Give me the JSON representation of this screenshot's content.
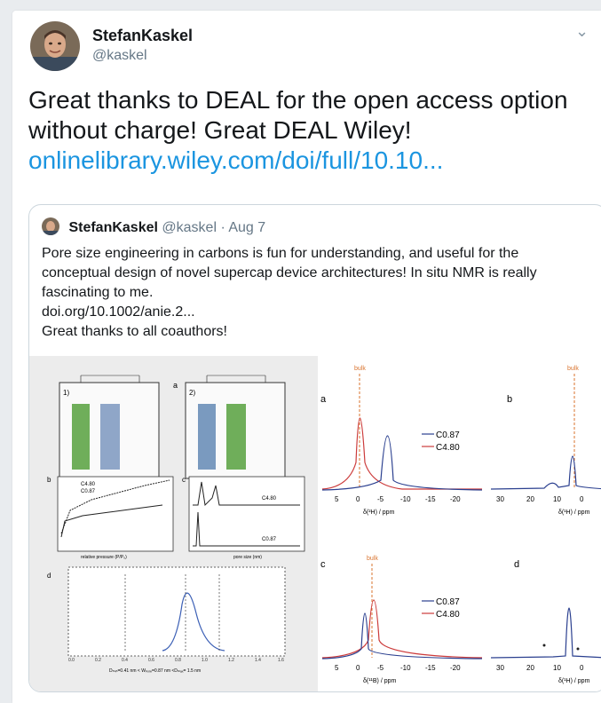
{
  "tweet": {
    "author_name": "StefanKaskel",
    "author_handle": "@kaskel",
    "text_line1": "Great thanks to DEAL for the open access option",
    "text_line2": "without charge! Great DEAL Wiley!",
    "link": "onlinelibrary.wiley.com/doi/full/10.10..."
  },
  "quoted": {
    "author_name": "StefanKaskel",
    "handle_date": "@kaskel · Aug 7",
    "lines": [
      "Pore size engineering in carbons is fun for understanding, and useful for the",
      "conceptual design of novel supercap device architectures! In situ NMR is really",
      "fascinating to me.",
      "doi.org/10.1002/anie.2...",
      "Great thanks to all coauthors!"
    ]
  },
  "figure": {
    "colors": {
      "blue": "#2a3f8f",
      "red": "#cc3b3b",
      "bulk": "#d9732e"
    },
    "left": {
      "panel1": "1)",
      "panel2": "2)",
      "panel_a": "a",
      "panel_b": "b",
      "panel_c": "c",
      "panel_d": "d",
      "legend_b": [
        "C4.80",
        "C0.87"
      ],
      "legend_c": [
        "C4.80",
        "C0.87"
      ],
      "xlabel_b": "relative pressure (P/P₀)",
      "xlabel_c": "pore size (nm)",
      "d_ticks": [
        "0.0",
        "0.2",
        "0.4",
        "0.6",
        "0.8",
        "1.0",
        "1.2",
        "1.4",
        "1.6"
      ],
      "d_caption": "Dₘᵢₙ=0.41 nm  <  Wₚₒᵣₑ=0.87 nm  <Dₘₐₓ= 1.5 nm"
    },
    "nmr": {
      "bulk": "bulk",
      "a": {
        "label": "a",
        "legend": [
          "C0.87",
          "C4.80"
        ],
        "ticks": [
          "5",
          "0",
          "-5",
          "-10",
          "-15",
          "-20"
        ],
        "xlabel": "δ(²H) / ppm"
      },
      "b": {
        "label": "b",
        "ticks": [
          "30",
          "20",
          "10",
          "0"
        ],
        "xlabel": "δ(¹H) / ppm"
      },
      "c": {
        "label": "c",
        "legend": [
          "C0.87",
          "C4.80"
        ],
        "ticks": [
          "5",
          "0",
          "-5",
          "-10",
          "-15",
          "-20"
        ],
        "xlabel": "δ(¹¹B) / ppm"
      },
      "d": {
        "label": "d",
        "ticks": [
          "30",
          "20",
          "10",
          "0"
        ],
        "xlabel": "δ(¹H) / ppm"
      }
    }
  }
}
